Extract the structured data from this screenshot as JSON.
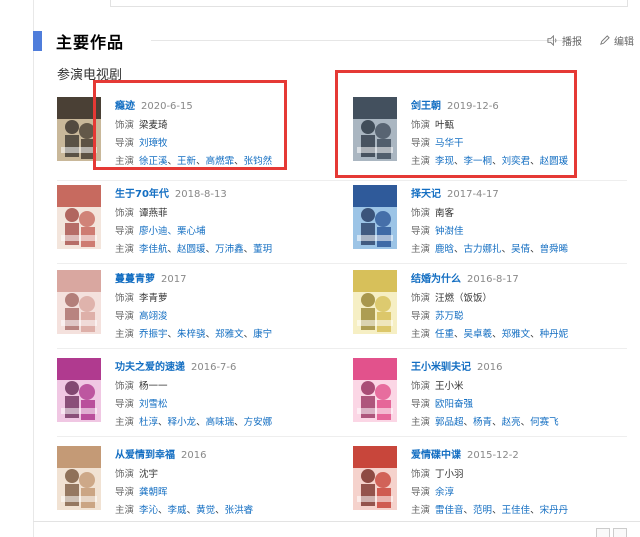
{
  "section": {
    "title": "主要作品",
    "subtitle": "参演电视剧",
    "actions": {
      "play": "播报",
      "edit": "编辑"
    },
    "labels": {
      "role": "饰演",
      "director": "导演",
      "cast": "主演"
    }
  },
  "works": [
    {
      "title": "瘾迹",
      "date": "2020-6-15",
      "role": "梁麦琦",
      "director": "刘璋牧",
      "cast": [
        "徐正溪",
        "王新",
        "高燃霏",
        "张钧然"
      ],
      "colors": [
        "#4a4035",
        "#c9b89a",
        "#2b2622"
      ]
    },
    {
      "title": "剑王朝",
      "date": "2019-12-6",
      "role": "叶甄",
      "director": "马华干",
      "cast": [
        "李现",
        "李一桐",
        "刘奕君",
        "赵圆瑗"
      ],
      "colors": [
        "#43505e",
        "#aab6c1",
        "#1e2a36"
      ]
    },
    {
      "title": "生于70年代",
      "date": "2018-8-13",
      "role": "谭燕菲",
      "director": "廖小迪、栗心埔",
      "cast": [
        "李佳航",
        "赵圆瑗",
        "万沛鑫",
        "董玥"
      ],
      "colors": [
        "#c76a5f",
        "#f3e5dc",
        "#9b3b35"
      ]
    },
    {
      "title": "择天记",
      "date": "2017-4-17",
      "role": "南客",
      "director": "钟澍佳",
      "cast": [
        "鹿晗",
        "古力娜扎",
        "吴倩",
        "曾舜晞"
      ],
      "colors": [
        "#2f5a9a",
        "#9cc4e6",
        "#1b2f55"
      ]
    },
    {
      "title": "蔓蔓青萝",
      "date": "2017",
      "role": "李青萝",
      "director": "高翊浚",
      "cast": [
        "乔振宇",
        "朱梓骁",
        "郑雅文",
        "康宁"
      ],
      "colors": [
        "#d9a7a0",
        "#f4e1dd",
        "#9e5d58"
      ]
    },
    {
      "title": "结婚为什么",
      "date": "2016-8-17",
      "role": "汪燃（饭饭）",
      "director": "苏万聪",
      "cast": [
        "任重",
        "吴卓羲",
        "郑雅文",
        "种丹妮"
      ],
      "colors": [
        "#d7c05a",
        "#f6efc4",
        "#8e7a24"
      ]
    },
    {
      "title": "功夫之爱的速递",
      "date": "2016-7-6",
      "role": "杨一一",
      "director": "刘雪松",
      "cast": [
        "杜淳",
        "释小龙",
        "高味瑞",
        "方安娜"
      ],
      "colors": [
        "#b03a8f",
        "#f0c7e3",
        "#5e1d4c"
      ]
    },
    {
      "title": "王小米驯夫记",
      "date": "2016",
      "role": "王小米",
      "director": "欧阳奋强",
      "cast": [
        "郭品超",
        "杨青",
        "赵亮",
        "何赛飞"
      ],
      "colors": [
        "#e2528c",
        "#fbd6e5",
        "#8d1f50"
      ]
    },
    {
      "title": "从爱情到幸福",
      "date": "2016",
      "role": "沈宇",
      "director": "龚朝晖",
      "cast": [
        "李沁",
        "李威",
        "黄觉",
        "张洪睿"
      ],
      "colors": [
        "#c49a76",
        "#f1e2d3",
        "#6e4b30"
      ]
    },
    {
      "title": "爱情碟中谍",
      "date": "2015-12-2",
      "role": "丁小羽",
      "director": "余淳",
      "cast": [
        "雷佳音",
        "范明",
        "王佳佳",
        "宋丹丹"
      ],
      "colors": [
        "#c8463b",
        "#f5d2cc",
        "#6b1c16"
      ]
    }
  ]
}
